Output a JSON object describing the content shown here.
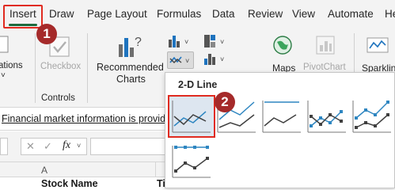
{
  "tabs": [
    "Insert",
    "Draw",
    "Page Layout",
    "Formulas",
    "Data",
    "Review",
    "View",
    "Automate",
    "He"
  ],
  "steps": [
    "1",
    "2"
  ],
  "ribbon": {
    "partial_label_1": "ations",
    "checkbox_label": "Checkbox",
    "controls_group": "Controls",
    "recommended_charts_line1": "Recommended",
    "recommended_charts_line2": "Charts",
    "maps_label": "Maps",
    "pivotchart_label": "PivotChart",
    "sparklines_label": "Sparklin"
  },
  "infobar": {
    "text": "Financial market information is provide"
  },
  "formula_bar": {
    "fx": "fx"
  },
  "sheet": {
    "column_a": "A",
    "cell_a1": "Stock Name",
    "cell_b1_partial": "Ti"
  },
  "dropdown": {
    "title": "2-D Line",
    "items": [
      "line",
      "stacked-line",
      "100%-stacked-line",
      "line-with-markers",
      "stacked-line-with-markers",
      "100%-stacked-line-with-markers"
    ]
  },
  "colors": {
    "tab_highlight": "#e02b20",
    "badge": "#a52a2a",
    "excel_green": "#1d6b3d",
    "series_blue": "#2e86c1",
    "series_dark": "#404040"
  }
}
